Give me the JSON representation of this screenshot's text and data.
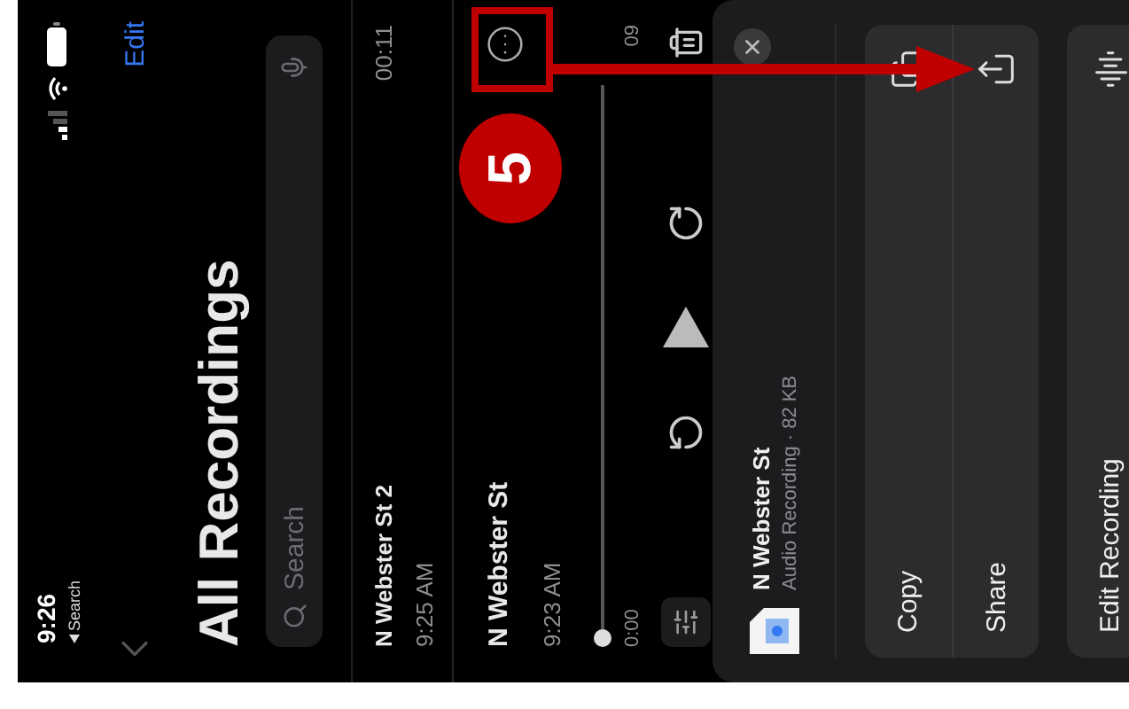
{
  "status_bar": {
    "time": "9:26",
    "back_link": "Search"
  },
  "nav": {
    "edit": "Edit"
  },
  "title": "All Recordings",
  "search": {
    "placeholder": "Search"
  },
  "recordings": [
    {
      "name": "N Webster St 2",
      "time": "9:25 AM",
      "duration": "00:11",
      "expanded": false
    },
    {
      "name": "N Webster St",
      "time": "9:23 AM",
      "expanded": true,
      "player": {
        "elapsed": "0:00",
        "remaining": "09",
        "level": 0
      }
    }
  ],
  "share_sheet": {
    "file": {
      "name": "N Webster St",
      "details": "Audio Recording · 82 KB"
    },
    "groups": [
      [
        {
          "kind": "copy",
          "label": "Copy"
        },
        {
          "kind": "share",
          "label": "Share"
        }
      ],
      [
        {
          "kind": "edit",
          "label": "Edit Recording"
        }
      ]
    ]
  },
  "annotation": {
    "step": "5"
  }
}
